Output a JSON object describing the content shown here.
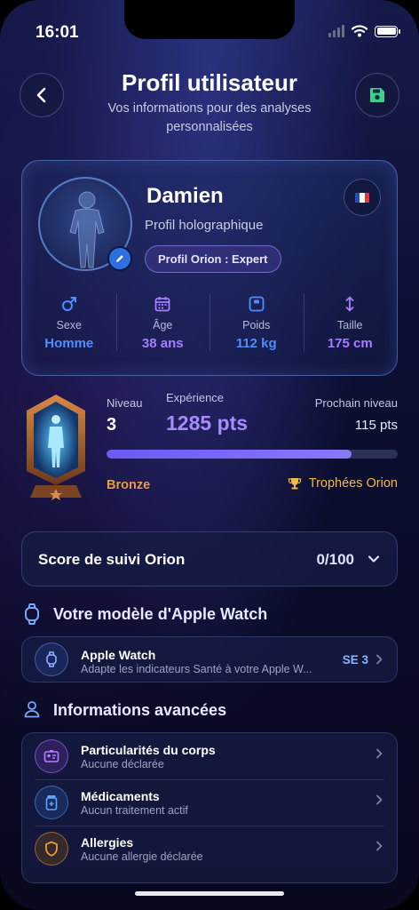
{
  "status_bar": {
    "time": "16:01"
  },
  "header": {
    "title": "Profil utilisateur",
    "subtitle": "Vos informations pour des analyses personnalisées"
  },
  "profile": {
    "name": "Damien",
    "description": "Profil holographique",
    "badge": "Profil Orion : Expert",
    "flag_colors": [
      "#1f4bbf",
      "#ffffff",
      "#e23b3b"
    ],
    "stats": [
      {
        "icon": "male-icon",
        "label": "Sexe",
        "value": "Homme",
        "color": "#4f8cff"
      },
      {
        "icon": "calendar-icon",
        "label": "Âge",
        "value": "38 ans",
        "color": "#a77dff"
      },
      {
        "icon": "scale-icon",
        "label": "Poids",
        "value": "112 kg",
        "color": "#4f8cff"
      },
      {
        "icon": "height-icon",
        "label": "Taille",
        "value": "175 cm",
        "color": "#a77dff"
      }
    ]
  },
  "level": {
    "level_label": "Niveau",
    "level_value": "3",
    "xp_label": "Expérience",
    "xp_value": "1285 pts",
    "next_label": "Prochain niveau",
    "next_value": "115 pts",
    "progress_fraction": 0.84,
    "rank": "Bronze",
    "trophies_label": "Trophées Orion"
  },
  "score": {
    "title": "Score de suivi Orion",
    "value": "0/100"
  },
  "watch_section": {
    "title": "Votre modèle d'Apple Watch",
    "item_title": "Apple Watch",
    "item_sub": "Adapte les indicateurs Santé à votre Apple W...",
    "item_value": "SE 3"
  },
  "advanced_section": {
    "title": "Informations avancées",
    "items": [
      {
        "title": "Particularités du corps",
        "sub": "Aucune déclarée",
        "icon": "body-card-icon",
        "color": "#b37dff"
      },
      {
        "title": "Médicaments",
        "sub": "Aucun traitement actif",
        "icon": "medication-icon",
        "color": "#5da8ff"
      },
      {
        "title": "Allergies",
        "sub": "Aucune allergie déclarée",
        "icon": "shield-icon",
        "color": "#f0a640"
      }
    ]
  }
}
